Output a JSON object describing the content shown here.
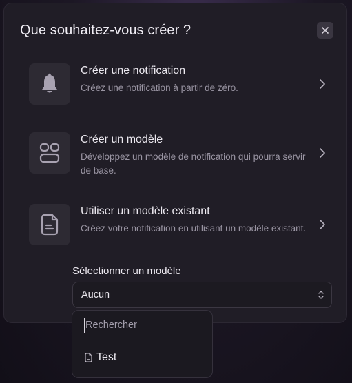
{
  "dialog": {
    "title": "Que souhaitez-vous créer ?",
    "close_icon": "close-icon"
  },
  "options": [
    {
      "icon": "bell-icon",
      "title": "Créer une notification",
      "description": "Créez une notification à partir de zéro."
    },
    {
      "icon": "layout-template-icon",
      "title": "Créer un modèle",
      "description": "Développez un modèle de notification qui pourra servir de base."
    },
    {
      "icon": "document-icon",
      "title": "Utiliser un modèle existant",
      "description": "Créez votre notification en utilisant un modèle existant."
    }
  ],
  "template_select": {
    "label": "Sélectionner un modèle",
    "value": "Aucun"
  },
  "dropdown": {
    "search_placeholder": "Rechercher",
    "items": [
      {
        "icon": "document-icon",
        "label": "Test"
      }
    ]
  }
}
